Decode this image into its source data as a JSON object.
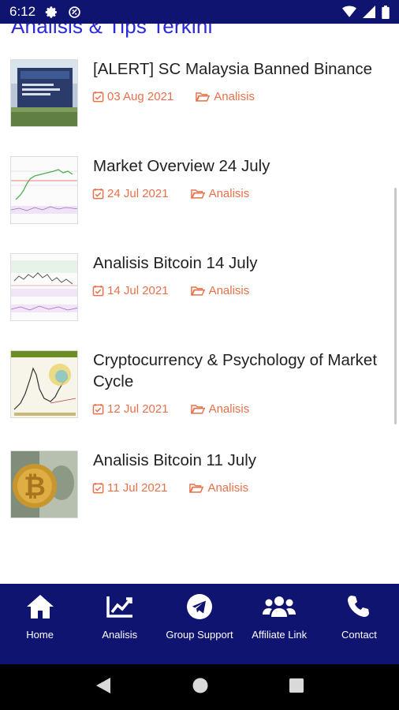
{
  "status_bar": {
    "time": "6:12",
    "icons": [
      "gear-icon",
      "data-saver-icon",
      "wifi-icon",
      "signal-icon",
      "battery-icon"
    ],
    "background": "#0f1470"
  },
  "section": {
    "title": "Analisis & Tips Terkini",
    "title_color": "#2a2ad8"
  },
  "articles": [
    {
      "title": "[ALERT] SC Malaysia Banned Binance",
      "date": "03 Aug 2021",
      "category": "Analisis",
      "thumb": "building-photo"
    },
    {
      "title": "Market Overview 24 July",
      "date": "24 Jul 2021",
      "category": "Analisis",
      "thumb": "chart-screenshot"
    },
    {
      "title": "Analisis Bitcoin 14 July",
      "date": "14 Jul 2021",
      "category": "Analisis",
      "thumb": "chart-screenshot"
    },
    {
      "title": "Cryptocurrency & Psychology of Market Cycle",
      "date": "12 Jul 2021",
      "category": "Analisis",
      "thumb": "market-cycle-chart"
    },
    {
      "title": "Analisis Bitcoin 11 July",
      "date": "11 Jul 2021",
      "category": "Analisis",
      "thumb": "bitcoin-coin-photo"
    }
  ],
  "meta_color": "#e8704a",
  "bottom_nav": {
    "background": "#0f1470",
    "items": [
      {
        "label": "Home",
        "icon": "home-icon"
      },
      {
        "label": "Analisis",
        "icon": "chart-line-icon"
      },
      {
        "label": "Group Support",
        "icon": "telegram-icon"
      },
      {
        "label": "Affiliate Link",
        "icon": "users-icon"
      },
      {
        "label": "Contact",
        "icon": "phone-icon"
      }
    ]
  },
  "system_nav": {
    "icons": [
      "back-icon",
      "home-circle-icon",
      "recents-icon"
    ]
  }
}
